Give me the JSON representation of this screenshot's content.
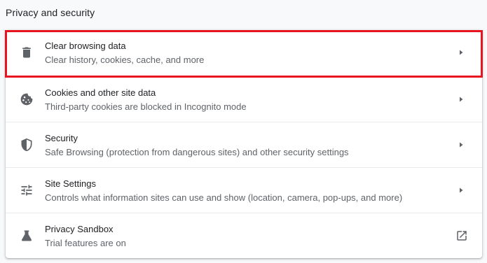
{
  "section": {
    "title": "Privacy and security"
  },
  "items": [
    {
      "title": "Clear browsing data",
      "subtitle": "Clear history, cookies, cache, and more",
      "icon": "trash-icon",
      "trailing": "arrow-right-icon"
    },
    {
      "title": "Cookies and other site data",
      "subtitle": "Third-party cookies are blocked in Incognito mode",
      "icon": "cookie-icon",
      "trailing": "arrow-right-icon"
    },
    {
      "title": "Security",
      "subtitle": "Safe Browsing (protection from dangerous sites) and other security settings",
      "icon": "shield-icon",
      "trailing": "arrow-right-icon"
    },
    {
      "title": "Site Settings",
      "subtitle": "Controls what information sites can use and show (location, camera, pop-ups, and more)",
      "icon": "tune-icon",
      "trailing": "arrow-right-icon"
    },
    {
      "title": "Privacy Sandbox",
      "subtitle": "Trial features are on",
      "icon": "flask-icon",
      "trailing": "open-in-new-icon"
    }
  ],
  "colors": {
    "highlight": "#e8141f",
    "icon": "#5f6368",
    "text_primary": "#202124",
    "text_secondary": "#5f6368"
  }
}
